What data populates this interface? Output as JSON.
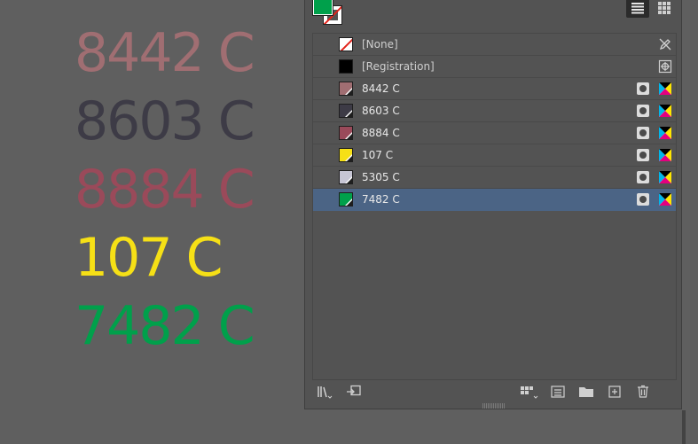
{
  "canvas": {
    "labels": [
      {
        "text": "8442 C",
        "color": "#a06e72"
      },
      {
        "text": "8603 C",
        "color": "#3d3b46"
      },
      {
        "text": "8884 C",
        "color": "#9a4a5a"
      },
      {
        "text": "107 C",
        "color": "#f6e016"
      },
      {
        "text": "7482 C",
        "color": "#00a04b"
      }
    ]
  },
  "swatches_panel": {
    "fill_color": "#00a04b",
    "view_modes": [
      "list-view-icon",
      "grid-view-icon"
    ],
    "swatches": [
      {
        "name": "[None]",
        "type": "none",
        "color": "#ffffff",
        "icon1": "no-edit-icon",
        "icon2": ""
      },
      {
        "name": "[Registration]",
        "type": "registration",
        "color": "#000000",
        "icon1": "registration-icon",
        "icon2": ""
      },
      {
        "name": "8442 C",
        "type": "spot",
        "color": "#a06e72",
        "icon1": "spot-color-icon",
        "icon2": "cmyk-icon"
      },
      {
        "name": "8603 C",
        "type": "spot",
        "color": "#3d3b46",
        "icon1": "spot-color-icon",
        "icon2": "cmyk-icon"
      },
      {
        "name": "8884 C",
        "type": "spot",
        "color": "#9a4a5a",
        "icon1": "spot-color-icon",
        "icon2": "cmyk-icon"
      },
      {
        "name": "107 C",
        "type": "spot",
        "color": "#f6e016",
        "icon1": "spot-color-icon",
        "icon2": "cmyk-icon"
      },
      {
        "name": "5305 C",
        "type": "spot",
        "color": "#c6c5d4",
        "icon1": "spot-color-icon",
        "icon2": "cmyk-icon"
      },
      {
        "name": "7482 C",
        "type": "spot",
        "color": "#00a04b",
        "icon1": "spot-color-icon",
        "icon2": "cmyk-icon",
        "selected": true
      }
    ],
    "bottom_tools": [
      "libraries-icon",
      "export-swatches-icon",
      "swatch-view-options-icon",
      "new-color-group-icon",
      "folder-icon",
      "new-swatch-icon",
      "delete-swatch-icon"
    ],
    "selection_color": "#4b6485"
  }
}
